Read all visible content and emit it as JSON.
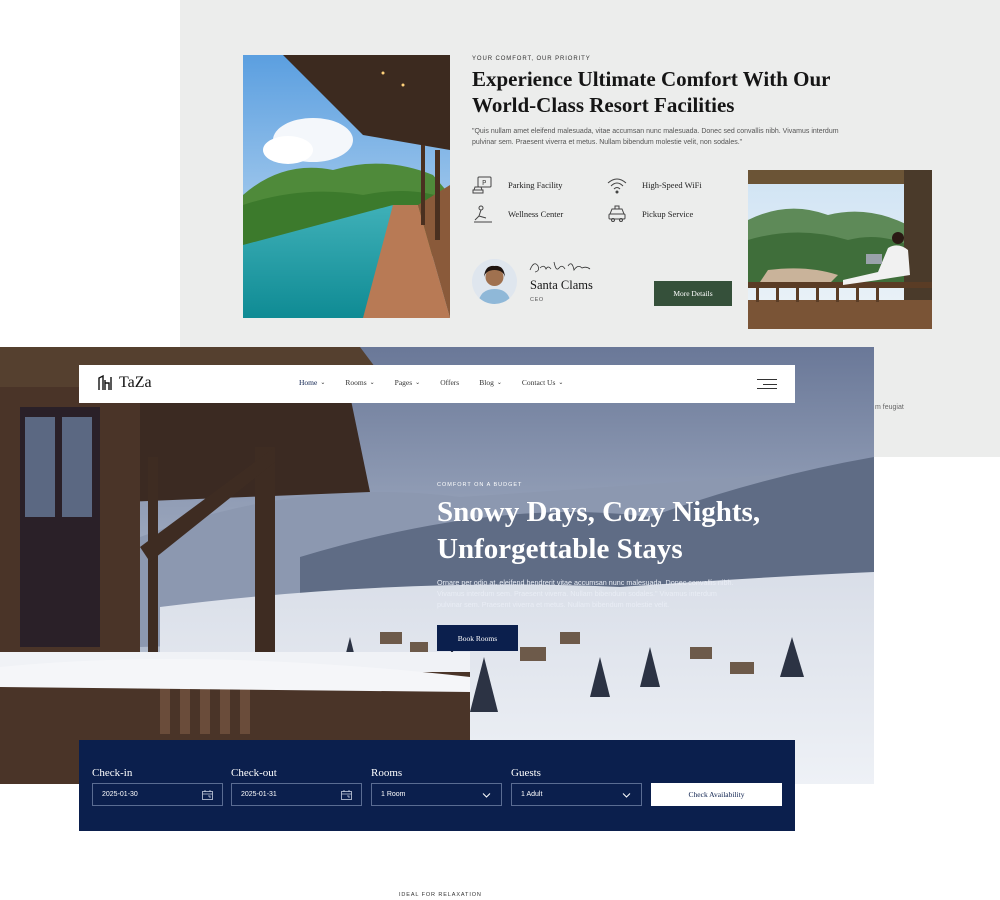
{
  "colors": {
    "navy": "#0b1f4d",
    "green_button": "#35503a",
    "panel_gray": "#ecedec"
  },
  "facilities": {
    "eyebrow": "YOUR COMFORT, OUR PRIORITY",
    "title": "Experience Ultimate Comfort With Our World-Class Resort Facilities",
    "description": "\"Quis nullam amet eleifend malesuada, vitae accumsan nunc malesuada. Donec sed convallis nibh. Vivamus interdum pulvinar sem. Praesent viverra et metus. Nullam bibendum molestie velit, non sodales.\"",
    "features": [
      {
        "label": "Parking Facility",
        "icon": "parking-icon"
      },
      {
        "label": "High-Speed WiFi",
        "icon": "wifi-icon"
      },
      {
        "label": "Wellness Center",
        "icon": "wellness-icon"
      },
      {
        "label": "Pickup Service",
        "icon": "car-icon"
      }
    ],
    "ceo": {
      "name": "Santa Clams",
      "role": "CEO"
    },
    "more_button": "More Details",
    "truncated_text": "m feugiat"
  },
  "navbar": {
    "logo": "TaZa",
    "items": [
      {
        "label": "Home",
        "has_dropdown": true,
        "active": true
      },
      {
        "label": "Rooms",
        "has_dropdown": true
      },
      {
        "label": "Pages",
        "has_dropdown": true
      },
      {
        "label": "Offers",
        "has_dropdown": false
      },
      {
        "label": "Blog",
        "has_dropdown": true
      },
      {
        "label": "Contact Us",
        "has_dropdown": true
      }
    ]
  },
  "hero": {
    "eyebrow": "COMFORT ON A BUDGET",
    "title_line1": "Snowy Days, Cozy Nights,",
    "title_line2": "Unforgettable Stays",
    "description": "Ornare per odio at, eleifend hendrerit vitae accumsan nunc malesuada. Donec convallis nibh. Vivamus interdum sem. Praesent viverra. Nullam bibendum sodales.\" Vivamus interdum pulvinar sem. Praesent viverra et metus. Nullam bibendum molestie velit.",
    "book_button": "Book Rooms"
  },
  "booking": {
    "checkin": {
      "label": "Check-in",
      "value": "2025-01-30"
    },
    "checkout": {
      "label": "Check-out",
      "value": "2025-01-31"
    },
    "rooms": {
      "label": "Rooms",
      "value": "1 Room"
    },
    "guests": {
      "label": "Guests",
      "value": "1 Adult"
    },
    "check_button": "Check Availability"
  },
  "next_section": {
    "eyebrow": "IDEAL FOR RELAXATION"
  }
}
